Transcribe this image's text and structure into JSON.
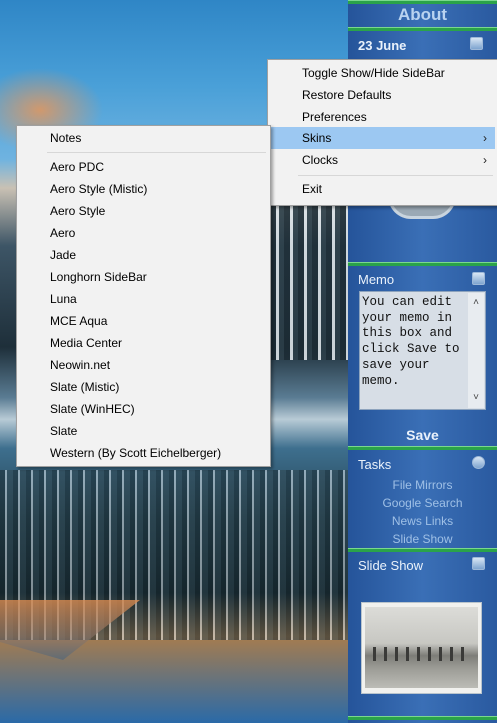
{
  "sidebar": {
    "about_label": "About",
    "date": "23 June",
    "memo": {
      "title": "Memo",
      "text": "You can edit your memo in this box and click Save to save your memo.",
      "save_label": "Save"
    },
    "tasks": {
      "title": "Tasks",
      "links": [
        "File Mirrors",
        "Google Search",
        "News Links",
        "Slide Show"
      ]
    },
    "slideshow": {
      "title": "Slide Show"
    }
  },
  "context_menu": {
    "items": [
      {
        "label": "Toggle Show/Hide SideBar"
      },
      {
        "label": "Restore Defaults"
      },
      {
        "label": "Preferences"
      },
      {
        "label": "Skins",
        "submenu": true,
        "highlighted": true
      },
      {
        "label": "Clocks",
        "submenu": true
      },
      {
        "label": "Exit"
      }
    ]
  },
  "skins_menu": {
    "items": [
      "Notes",
      "Aero PDC",
      "Aero Style (Mistic)",
      "Aero Style",
      "Aero",
      "Jade",
      "Longhorn SideBar",
      "Luna",
      "MCE Aqua",
      "Media Center",
      "Neowin.net",
      "Slate (Mistic)",
      "Slate (WinHEC)",
      "Slate",
      "Western (By Scott Eichelberger)"
    ]
  },
  "colors": {
    "sidebar": "#2c5fa6",
    "accent_stripe": "#2aa34a",
    "menu_highlight": "#9cc8f2"
  },
  "icons": {
    "submenu": "chevron-right-icon",
    "gadget": "gadget-settings-icon"
  }
}
